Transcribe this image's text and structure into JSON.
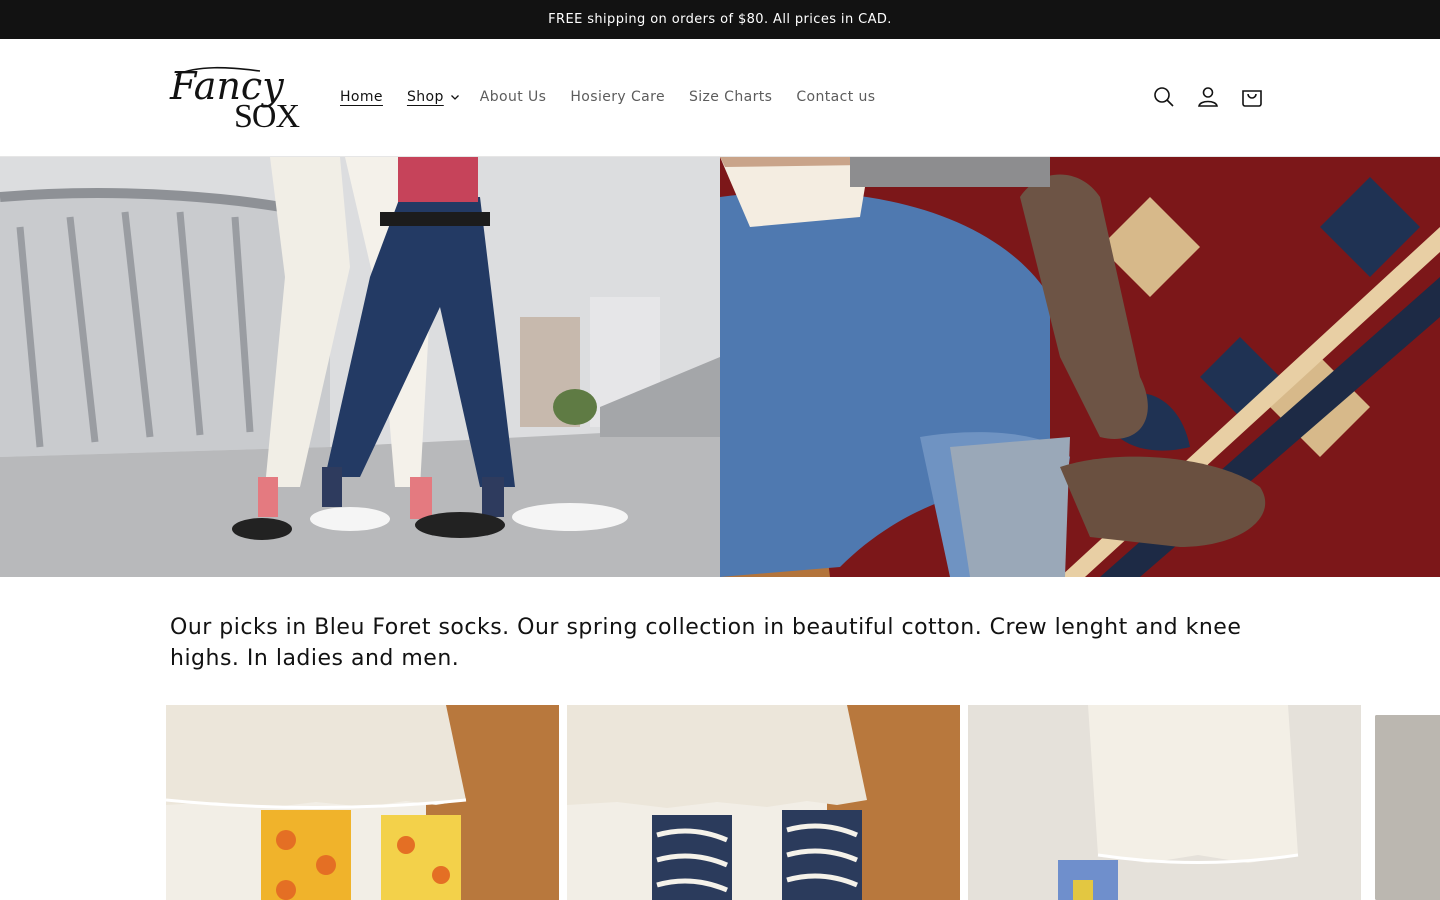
{
  "announcement": {
    "text": "FREE shipping on orders of $80. All prices in CAD."
  },
  "header": {
    "logo": {
      "line1": "Fancy",
      "line2": "SOX"
    },
    "nav": [
      {
        "label": "Home",
        "active": true
      },
      {
        "label": "Shop",
        "has_dropdown": true
      },
      {
        "label": "About Us"
      },
      {
        "label": "Hosiery Care"
      },
      {
        "label": "Size Charts"
      },
      {
        "label": "Contact us"
      }
    ],
    "icons": [
      "search-icon",
      "account-icon",
      "cart-icon"
    ]
  },
  "hero": {
    "left_image": "couple walking on bridge wearing pink socks and loafers",
    "right_image": "person in jeans and brown socks on red persian rug reading a book"
  },
  "collection": {
    "description": "Our picks in Bleu Foret socks. Our spring collection in beautiful cotton. Crew lenght and knee highs. In ladies and men."
  },
  "colors": {
    "announcement_bg": "#121212",
    "text": "#121212",
    "nav_muted": "#5c5c5c"
  }
}
